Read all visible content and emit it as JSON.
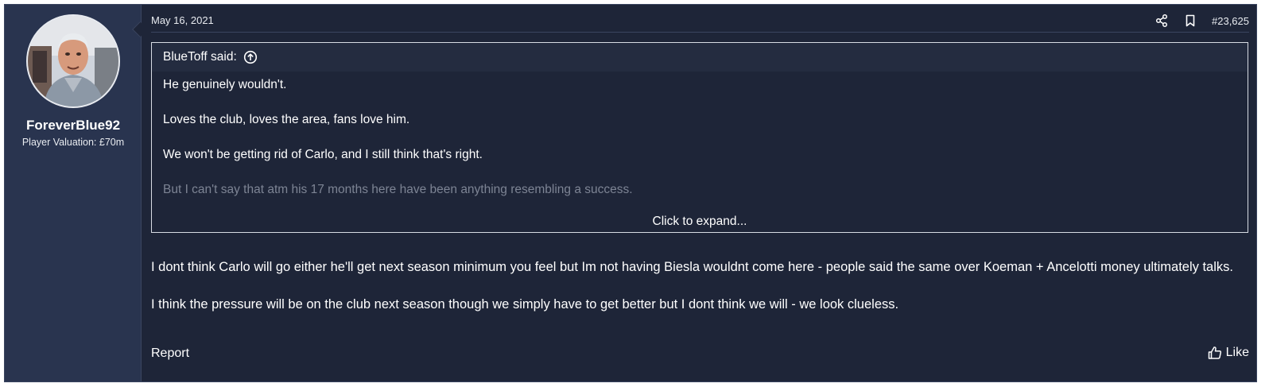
{
  "user": {
    "username": "ForeverBlue92",
    "user_title": "Player Valuation: £70m"
  },
  "post": {
    "date": "May 16, 2021",
    "number": "#23,625",
    "icons": [
      "share-icon",
      "bookmark-icon"
    ]
  },
  "quote": {
    "attribution": "BlueToff said:",
    "lines": [
      "He genuinely wouldn't.",
      "Loves the club, loves the area, fans love him.",
      "We won't be getting rid of Carlo, and I still think that's right.",
      "But I can't say that atm his 17 months here have been anything resembling a success."
    ],
    "expand_label": "Click to expand..."
  },
  "message": {
    "paragraphs": [
      "I dont think Carlo will go either he'll get next season minimum you feel but Im not having Biesla wouldnt come here - people said the same over Koeman + Ancelotti money ultimately talks.",
      "I think the pressure will be on the club next season though we simply have to get better but I dont think we will - we look clueless."
    ]
  },
  "footer": {
    "report_label": "Report",
    "like_label": "Like"
  },
  "colors": {
    "background": "#1e2538",
    "user_panel": "#29344f",
    "text": "#ffffff",
    "faded_text": "#7d8494",
    "border": "#3a4560"
  }
}
